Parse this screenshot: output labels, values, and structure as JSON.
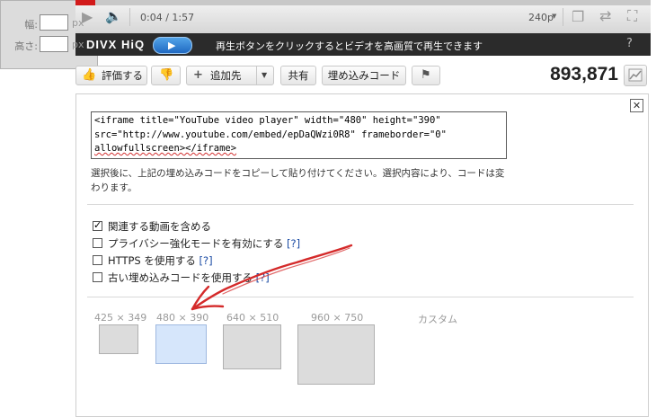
{
  "player": {
    "time": "0:04 / 1:57",
    "quality": "240p",
    "progress_fraction": 0.034,
    "icons": [
      "play-icon",
      "volume-icon",
      "pop-out-icon",
      "expand-icon",
      "fullscreen-icon"
    ]
  },
  "divx": {
    "logo": "DIVX HiQ",
    "message": "再生ボタンをクリックするとビデオを高画質で再生できます",
    "help": "?"
  },
  "actions": {
    "rate_label": "評価する",
    "add_label": "追加先",
    "share_label": "共有",
    "embed_label": "埋め込みコード",
    "views": "893,871"
  },
  "embed": {
    "code_lines": [
      "<iframe title=\"YouTube video player\" width=\"480\" height=\"390\"",
      "src=\"http://www.youtube.com/embed/epDaQWzi0R8\" frameborder=\"0\"",
      "allowfullscreen></iframe>"
    ],
    "instruction": "選択後に、上記の埋め込みコードをコピーして貼り付けてください。選択内容により、コードは変わります。",
    "close": "✕",
    "options": [
      {
        "label": "関連する動画を含める",
        "help": "",
        "checked": true
      },
      {
        "label": "プライバシー強化モードを有効にする",
        "help": "[?]",
        "checked": false
      },
      {
        "label": "HTTPS を使用する",
        "help": "[?]",
        "checked": false
      },
      {
        "label": "古い埋め込みコードを使用する",
        "help": "[?]",
        "checked": false
      }
    ],
    "sizes": [
      {
        "label": "425 × 349",
        "selected": false
      },
      {
        "label": "480 × 390",
        "selected": true
      },
      {
        "label": "640 × 510",
        "selected": false
      },
      {
        "label": "960 × 750",
        "selected": false
      }
    ],
    "custom": {
      "label": "カスタム",
      "width_label": "幅:",
      "height_label": "高さ:",
      "unit": "px",
      "width_value": "",
      "height_value": ""
    }
  },
  "colors": {
    "annotation": "#d42a2a",
    "selected_size": "#d6e6fb",
    "divx_bar": "#2b2b2b"
  }
}
